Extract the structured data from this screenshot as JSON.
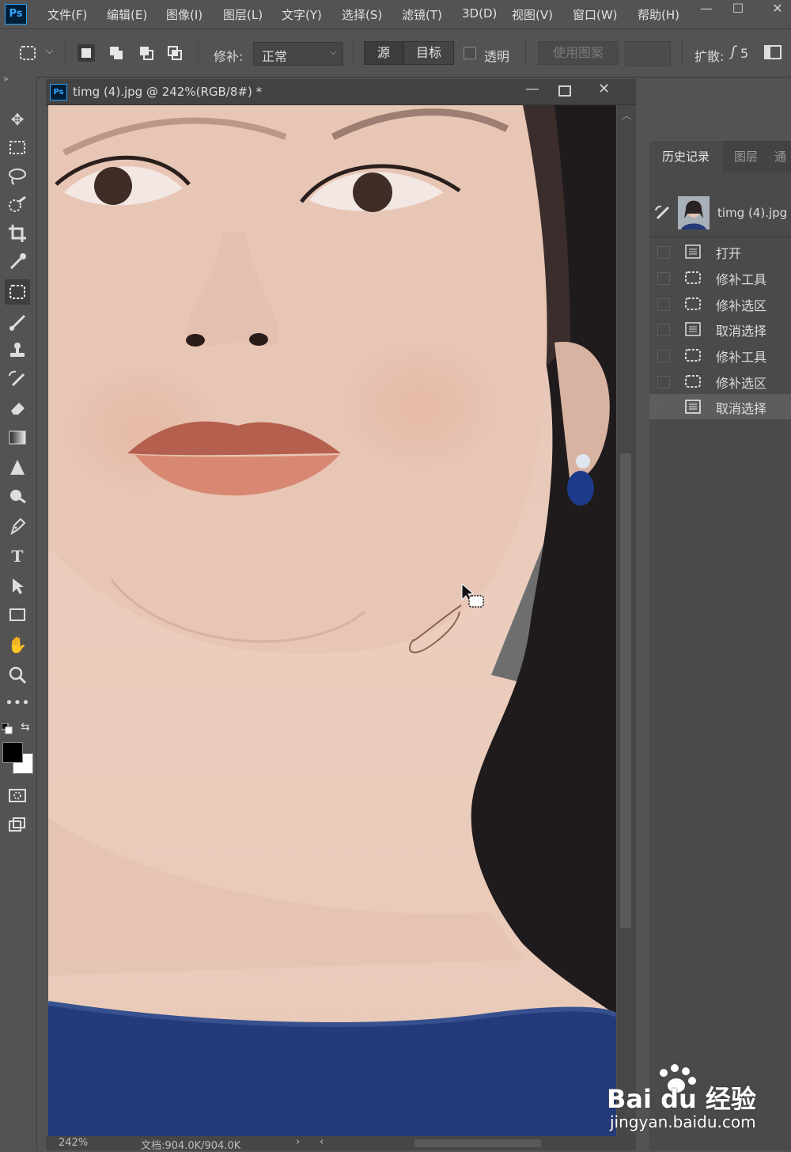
{
  "app": {
    "logo": "Ps"
  },
  "menu": [
    "文件(F)",
    "编辑(E)",
    "图像(I)",
    "图层(L)",
    "文字(Y)",
    "选择(S)",
    "滤镜(T)",
    "3D(D)",
    "视图(V)",
    "窗口(W)",
    "帮助(H)"
  ],
  "window_controls": {
    "minimize": "—",
    "maximize": "☐",
    "close": "✕"
  },
  "options": {
    "patch_label": "修补:",
    "patch_mode": "正常",
    "source_label": "源",
    "target_label": "目标",
    "transparent_label": "透明",
    "transparent_checked": false,
    "use_pattern_label": "使用图案",
    "diffusion_label": "扩散:",
    "diffusion_value": "5"
  },
  "document": {
    "tab_title": "timg (4).jpg @ 242%(RGB/8#) *",
    "zoom": "242%",
    "doc_size": "文档:904.0K/904.0K"
  },
  "panel": {
    "tabs": [
      "历史记录",
      "图层",
      "通"
    ],
    "snapshot_name": "timg (4).jpg",
    "history": [
      {
        "label": "打开",
        "icon": "document-icon"
      },
      {
        "label": "修补工具",
        "icon": "patch-tool-icon"
      },
      {
        "label": "修补选区",
        "icon": "patch-tool-icon"
      },
      {
        "label": "取消选择",
        "icon": "document-icon"
      },
      {
        "label": "修补工具",
        "icon": "patch-tool-icon"
      },
      {
        "label": "修补选区",
        "icon": "patch-tool-icon"
      },
      {
        "label": "取消选择",
        "icon": "document-icon"
      }
    ],
    "active_history_index": 6
  },
  "watermark": {
    "brand": "Bai du 经验",
    "url": "jingyan.baidu.com"
  },
  "colors": {
    "accent": "#31a8ff",
    "foreground": "#000000",
    "background": "#ffffff"
  }
}
